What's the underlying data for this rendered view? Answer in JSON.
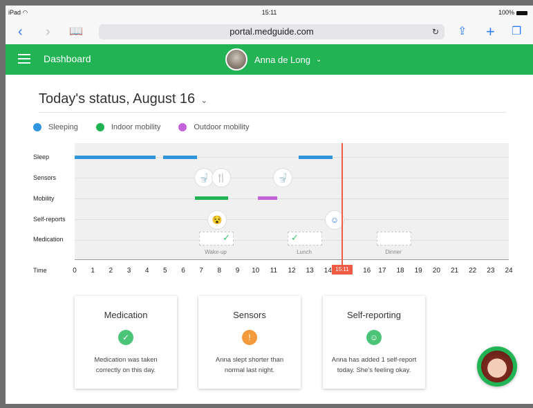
{
  "status_bar": {
    "device": "iPad",
    "time": "15:11",
    "battery": "100%"
  },
  "browser": {
    "url": "portal.medguide.com"
  },
  "app_bar": {
    "title": "Dashboard",
    "user_name": "Anna de Long"
  },
  "page": {
    "heading": "Today's status, August 16"
  },
  "legend": [
    {
      "label": "Sleeping",
      "color": "#2f95dc"
    },
    {
      "label": "Indoor mobility",
      "color": "#21b354"
    },
    {
      "label": "Outdoor mobility",
      "color": "#c264d8"
    }
  ],
  "timeline": {
    "rows": [
      "Sleep",
      "Sensors",
      "Mobility",
      "Self-reports",
      "Medication",
      "Time"
    ],
    "hours": [
      "0",
      "1",
      "2",
      "3",
      "4",
      "5",
      "6",
      "7",
      "8",
      "9",
      "10",
      "11",
      "12",
      "13",
      "14",
      "15",
      "16",
      "17",
      "18",
      "19",
      "20",
      "21",
      "22",
      "23",
      "24"
    ],
    "now_label": "15:11",
    "medication_slots": [
      "Wake-up",
      "Lunch",
      "Dinner"
    ]
  },
  "cards": [
    {
      "title": "Medication",
      "body": "Medication was taken correctly on this day.",
      "icon": "check-icon",
      "color": "#4cc477"
    },
    {
      "title": "Sensors",
      "body": "Anna slept shorter than normal last night.",
      "icon": "exclamation-icon",
      "color": "#f29a3c"
    },
    {
      "title": "Self-reporting",
      "body": "Anna has added 1 self-report today. She's feeling okay.",
      "icon": "smiley-icon",
      "color": "#4cc477"
    }
  ]
}
